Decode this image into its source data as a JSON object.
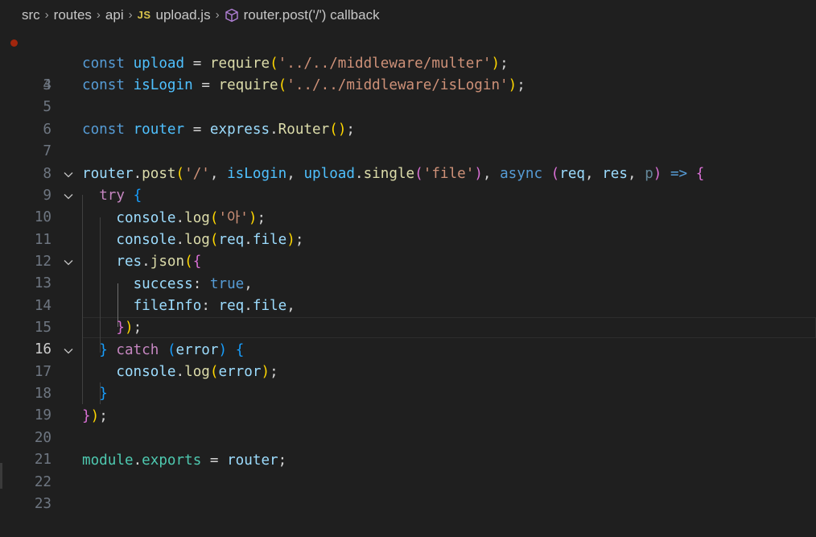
{
  "breadcrumb": {
    "items": [
      "src",
      "routes",
      "api",
      "upload.js",
      "router.post('/') callback"
    ],
    "js_badge": "JS",
    "separator": "›"
  },
  "gutter": {
    "line_numbers": [
      "3",
      "4",
      "5",
      "6",
      "7",
      "8",
      "9",
      "10",
      "11",
      "12",
      "13",
      "14",
      "15",
      "16",
      "17",
      "18",
      "19",
      "20",
      "21",
      "22",
      "23"
    ],
    "active_line": "16",
    "breakpoint_line": "3"
  },
  "code": {
    "l4": [
      "const",
      "upload",
      "=",
      "require",
      "(",
      "'../../middleware/multer'",
      ")",
      ";"
    ],
    "l5": [
      "const",
      "isLogin",
      "=",
      "require",
      "(",
      "'../../middleware/isLogin'",
      ")",
      ";"
    ],
    "l7": [
      "const",
      "router",
      "=",
      "express",
      ".",
      "Router",
      "(",
      ")",
      ";"
    ],
    "l9": [
      "router",
      ".",
      "post",
      "(",
      "'/'",
      ",",
      "isLogin",
      ",",
      "upload",
      ".",
      "single",
      "(",
      "'file'",
      ")",
      ",",
      "async",
      "(",
      "req",
      ",",
      "res",
      ",",
      "p",
      ")",
      "=>",
      "{"
    ],
    "l10": [
      "try",
      "{"
    ],
    "l11": [
      "console",
      ".",
      "log",
      "(",
      "'아'",
      ")",
      ";"
    ],
    "l12": [
      "console",
      ".",
      "log",
      "(",
      "req",
      ".",
      "file",
      ")",
      ";"
    ],
    "l13": [
      "res",
      ".",
      "json",
      "(",
      "{"
    ],
    "l14": [
      "success",
      ":",
      "true",
      ","
    ],
    "l15": [
      "fileInfo",
      ":",
      "req",
      ".",
      "file",
      ","
    ],
    "l16": [
      "}",
      ")",
      ";"
    ],
    "l17": [
      "}",
      "catch",
      "(",
      "error",
      ")",
      "{"
    ],
    "l18": [
      "console",
      ".",
      "log",
      "(",
      "error",
      ")",
      ";"
    ],
    "l19": [
      "}"
    ],
    "l20": [
      "}",
      ")",
      ";"
    ],
    "l22": [
      "module",
      ".",
      "exports",
      "=",
      "router",
      ";"
    ]
  },
  "colors": {
    "background": "#1f1f1f",
    "keyword": "#569cd6",
    "control": "#c586c0",
    "variable": "#9cdcfe",
    "constant": "#4fc1ff",
    "function": "#dcdcaa",
    "class": "#4ec9b0",
    "string": "#ce9178",
    "bracket1": "#ffd700",
    "bracket2": "#da70d6",
    "bracket3": "#179fff",
    "breakpoint": "#a1260d"
  },
  "icons": [
    "chevron-right-icon",
    "cube-icon",
    "fold-chevron-icon",
    "breakpoint-dot"
  ]
}
